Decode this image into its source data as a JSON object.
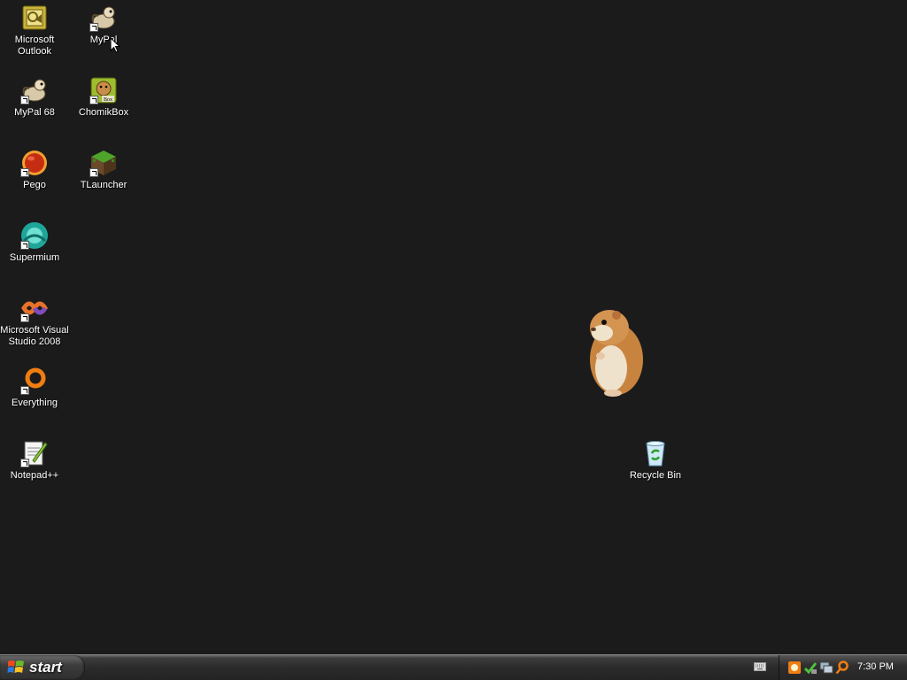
{
  "desktop": {
    "icons": [
      {
        "label": "Microsoft\nOutlook",
        "icon": "outlook-icon"
      },
      {
        "label": "MyPal",
        "icon": "mypal-icon"
      },
      {
        "label": "MyPal 68",
        "icon": "mypal-icon"
      },
      {
        "label": "ChomikBox",
        "icon": "chomikbox-icon"
      },
      {
        "label": "Pego",
        "icon": "pego-icon"
      },
      {
        "label": "TLauncher",
        "icon": "tlauncher-icon"
      },
      {
        "label": "Supermium",
        "icon": "supermium-icon"
      },
      {
        "label": "Microsoft Visual\nStudio 2008",
        "icon": "visual-studio-icon"
      },
      {
        "label": "Everything",
        "icon": "everything-icon"
      },
      {
        "label": "Notepad++",
        "icon": "notepad-plus-plus-icon"
      },
      {
        "label": "Recycle Bin",
        "icon": "recycle-bin-icon"
      }
    ],
    "background_color": "#1b1b1b"
  },
  "taskbar": {
    "start_label": "start",
    "clock": "7:30 PM",
    "tray_icons": [
      "chomikbox-tray-icon",
      "network-check-icon",
      "network-tray-icon",
      "everything-search-icon"
    ]
  }
}
